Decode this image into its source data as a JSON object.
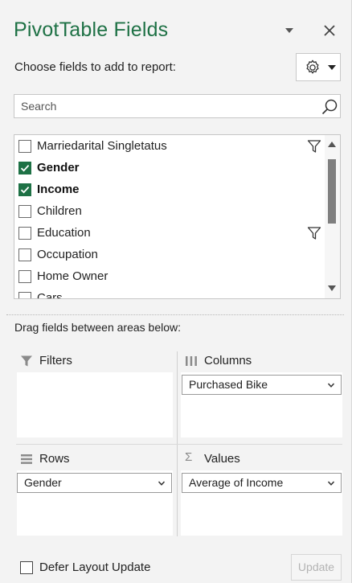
{
  "pane": {
    "title": "PivotTable Fields",
    "choose_label": "Choose fields to add to report:",
    "accent_color": "#1e7145"
  },
  "search": {
    "placeholder": "Search",
    "value": ""
  },
  "fields": [
    {
      "label": "Marriedarital Singletatus",
      "checked": false,
      "filtered": true
    },
    {
      "label": "Gender",
      "checked": true,
      "filtered": false
    },
    {
      "label": "Income",
      "checked": true,
      "filtered": false
    },
    {
      "label": "Children",
      "checked": false,
      "filtered": false
    },
    {
      "label": "Education",
      "checked": false,
      "filtered": true
    },
    {
      "label": "Occupation",
      "checked": false,
      "filtered": false
    },
    {
      "label": "Home Owner",
      "checked": false,
      "filtered": false
    },
    {
      "label": "Cars",
      "checked": false,
      "filtered": false
    }
  ],
  "areas": {
    "drag_label": "Drag fields between areas below:",
    "filters": {
      "label": "Filters",
      "icon": "filter-icon",
      "items": []
    },
    "columns": {
      "label": "Columns",
      "icon": "columns-icon",
      "items": [
        "Purchased Bike"
      ]
    },
    "rows": {
      "label": "Rows",
      "icon": "rows-icon",
      "items": [
        "Gender"
      ]
    },
    "values": {
      "label": "Values",
      "icon": "sigma-icon",
      "items": [
        "Average of Income"
      ]
    }
  },
  "footer": {
    "defer_label": "Defer Layout Update",
    "defer_checked": false,
    "update_label": "Update",
    "update_enabled": false
  }
}
